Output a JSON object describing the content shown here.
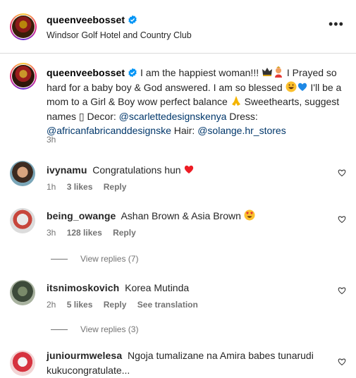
{
  "header": {
    "username": "queenveebosset",
    "location": "Windsor Golf Hotel and Country Club",
    "more_label": "•••"
  },
  "caption": {
    "username": "queenveebosset",
    "text_1": "I am the happiest woman!!!",
    "text_2": "I Prayed so hard for a baby boy & God answered. I am so blessed",
    "text_3": "I'll be a mom to a Girl & Boy wow perfect balance",
    "text_4": "Sweethearts, suggest names",
    "text_5": "Decor:",
    "decor_link": "@scarlettedesignskenya",
    "text_6": "Dress:",
    "dress_link": "@africanfabricanddesignske",
    "text_7": "Hair:",
    "hair_link": "@solange.hr_stores",
    "time": "3h"
  },
  "comments": [
    {
      "username": "ivynamu",
      "text": "Congratulations hun",
      "time": "1h",
      "likes": "3 likes",
      "reply": "Reply"
    },
    {
      "username": "being_owange",
      "text": "Ashan Brown & Asia Brown",
      "time": "3h",
      "likes": "128 likes",
      "reply": "Reply",
      "view_replies": "View replies (7)"
    },
    {
      "username": "itsnimoskovich",
      "text": "Korea Mutinda",
      "time": "2h",
      "likes": "5 likes",
      "reply": "Reply",
      "translate": "See translation",
      "view_replies": "View replies (3)"
    },
    {
      "username": "juniourmwelesa",
      "text_line1": "Ngoja tumalizane na Amira babes tunarudi",
      "text_line2": "kukucongratulate..."
    }
  ],
  "colors": {
    "link": "#00376b",
    "secondary_text": "#737373",
    "verified": "#0095f6",
    "heart_red": "#ed1c24"
  }
}
